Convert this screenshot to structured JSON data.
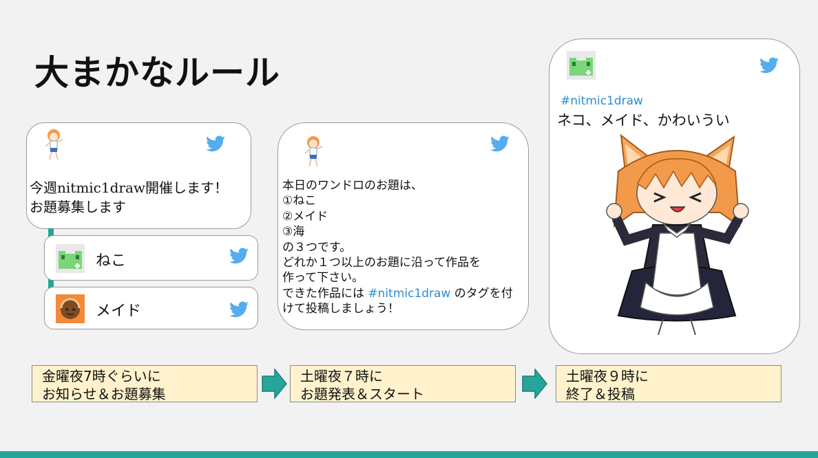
{
  "slide": {
    "title": "大まかなルール",
    "accent_color": "#26a69a"
  },
  "tweet_main": {
    "icon": "twitter-bird-icon",
    "avatar": "anime-girl-avatar",
    "line1": "今週nitmic1draw開催します！",
    "line2": "お題募集します"
  },
  "replies": [
    {
      "avatar": "green-frog-avatar",
      "label": "ねこ",
      "icon": "twitter-bird-icon"
    },
    {
      "avatar": "orange-face-avatar",
      "label": "メイド",
      "icon": "twitter-bird-icon"
    }
  ],
  "tweet_topics": {
    "avatar": "anime-girl-avatar",
    "icon": "twitter-bird-icon",
    "lines": [
      "本日のワンドロのお題は、",
      "①ねこ",
      "②メイド",
      "③海",
      "の３つです。",
      "どれか１つ以上のお題に沿って作品を",
      "作って下さい。"
    ],
    "tag_prefix": "できた作品には ",
    "hashtag": "#nitmic1draw",
    "tag_suffix": " のタグを付",
    "last_line": "けて投稿しましょう！"
  },
  "tweet_post": {
    "avatar": "green-frog-avatar",
    "icon": "twitter-bird-icon",
    "hashtag": "#nitmic1draw",
    "text": "ネコ、メイド、かわいうい",
    "illustration": "cat-maid-girl-illustration"
  },
  "timeline": [
    {
      "line1": "金曜夜7時ぐらいに",
      "line2": "お知らせ＆お題募集"
    },
    {
      "line1": "土曜夜７時に",
      "line2": "お題発表＆スタート"
    },
    {
      "line1": "土曜夜９時に",
      "line2": "終了＆投稿"
    }
  ]
}
